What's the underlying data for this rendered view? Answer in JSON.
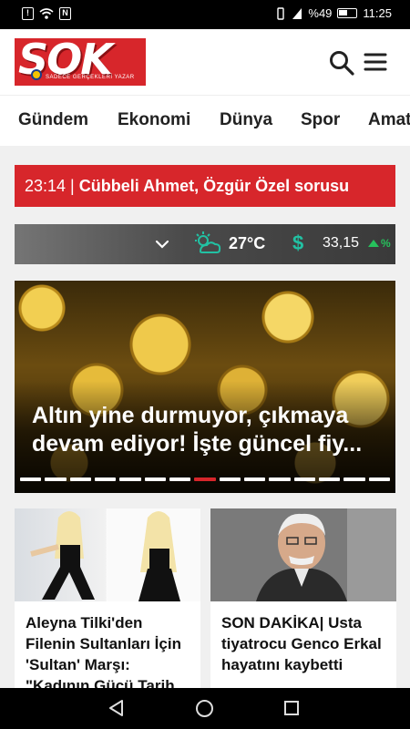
{
  "status_bar": {
    "battery": "%49",
    "time": "11:25"
  },
  "header": {
    "logo_text": "SOK",
    "logo_tagline": "SADECE GERÇEKLERİ YAZAR"
  },
  "nav": {
    "items": [
      "Gündem",
      "Ekonomi",
      "Dünya",
      "Spor",
      "Amat"
    ]
  },
  "breaking": {
    "time": "23:14 |",
    "headline": "Cübbeli Ahmet, Özgür Özel sorusu"
  },
  "info_bar": {
    "temperature": "27°C",
    "currency_symbol": "$",
    "rate": "33,15",
    "change": "%",
    "accent_color": "#22c1a3"
  },
  "hero": {
    "title": "Altın yine durmuyor, çıkmaya devam ediyor! İşte güncel fiy...",
    "slide_count": 15,
    "active_slide": 8
  },
  "cards": [
    {
      "title": "Aleyna Tilki'den Filenin Sultanları İçin 'Sultan' Marşı: \"Kadının Gücü Tarih"
    },
    {
      "title": "SON DAKİKA| Usta tiyatrocu Genco Erkal hayatını kaybetti"
    }
  ],
  "colors": {
    "brand_red": "#d7262b"
  }
}
